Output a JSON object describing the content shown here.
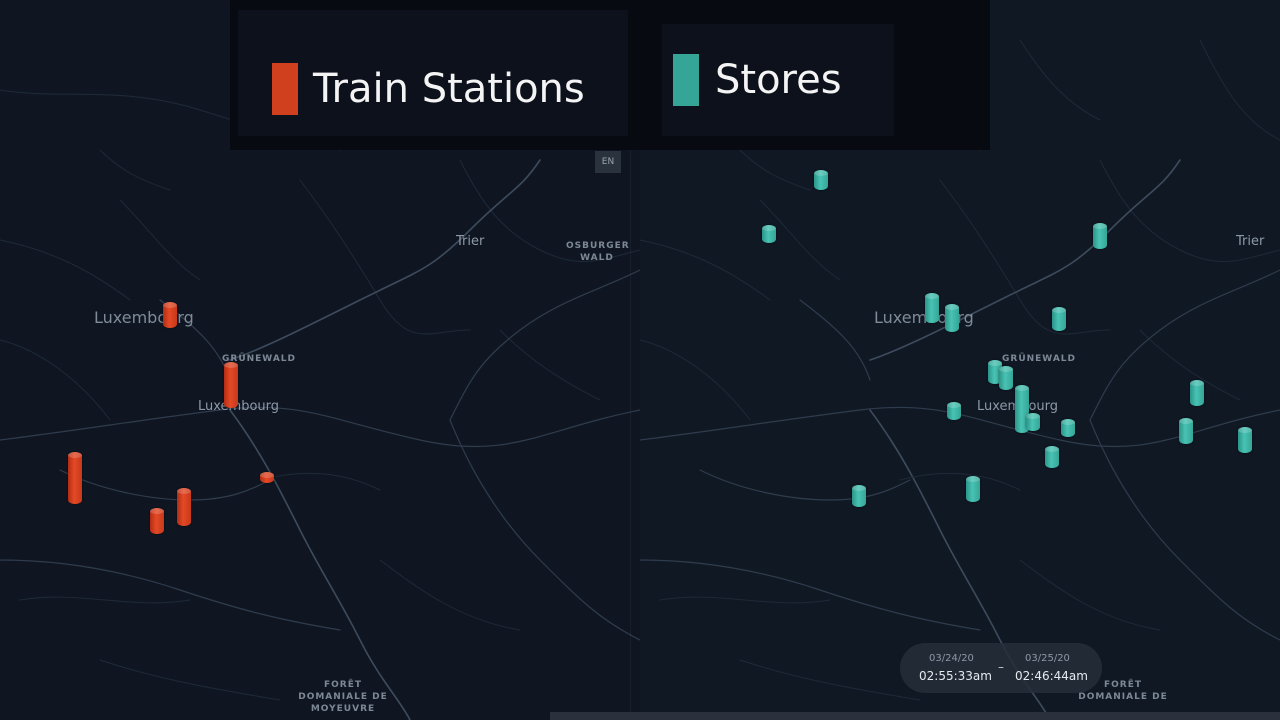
{
  "legend": {
    "items": [
      {
        "label": "Train Stations",
        "color": "#d0401e"
      },
      {
        "label": "Stores",
        "color": "#34a597"
      }
    ]
  },
  "language_badge": "EN",
  "left_map": {
    "places": {
      "luxembourg_region": "Luxembourg",
      "grunewald": "GRÜNEWALD",
      "luxembourg_city": "Luxembourg",
      "trier": "Trier",
      "osburger_wald": "OSBURGER\nWALD",
      "foret": "FORÊT\nDOMANIALE DE\nMOYEUVRE"
    }
  },
  "right_map": {
    "places": {
      "luxembourg_region": "Luxembourg",
      "grunewald": "GRÜNEWALD",
      "luxembourg_city": "Luxembourg",
      "trier": "Trier",
      "foret": "FORÊT\nDOMANIALE DE"
    }
  },
  "time_range": {
    "start_date": "03/24/20",
    "start_time": "02:55:33am",
    "separator": "–",
    "end_date": "03/25/20",
    "end_time": "02:46:44am"
  },
  "layers": {
    "train_stations_color": "#d0401e",
    "stores_color": "#34a597"
  }
}
